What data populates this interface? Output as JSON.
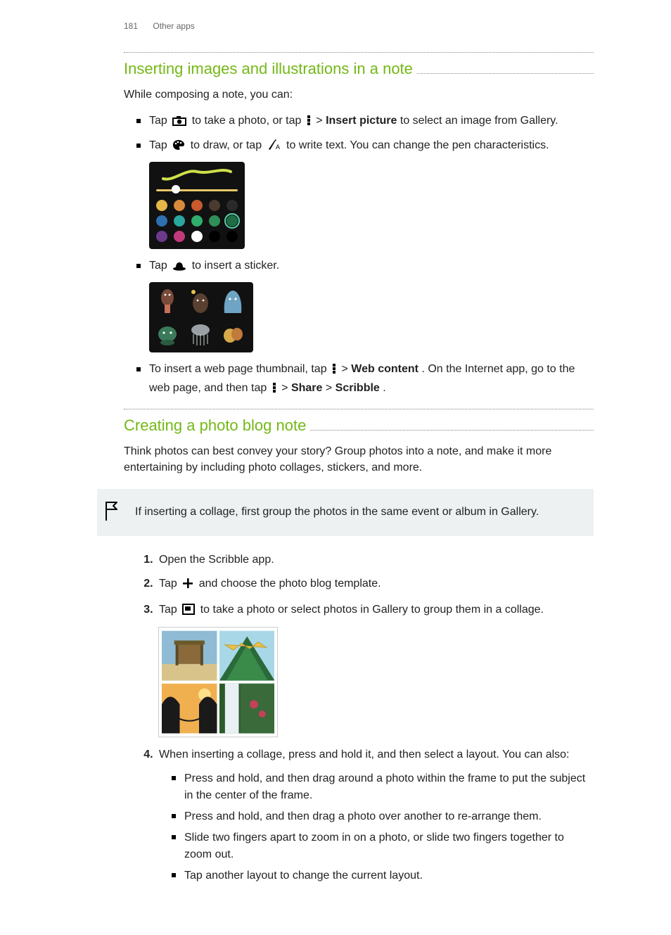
{
  "header": {
    "page_number": "181",
    "section": "Other apps"
  },
  "s1": {
    "title": "Inserting images and illustrations in a note",
    "intro": "While composing a note, you can:",
    "b1_a": "Tap ",
    "b1_b": " to take a photo, or tap ",
    "b1_c": " > ",
    "b1_d": "Insert picture",
    "b1_e": " to select an image from Gallery.",
    "b2_a": "Tap ",
    "b2_b": " to draw, or tap ",
    "b2_c": " to write text. You can change the pen characteristics.",
    "b3_a": "Tap ",
    "b3_b": " to insert a sticker.",
    "b4_a": "To insert a web page thumbnail, tap ",
    "b4_b": " > ",
    "b4_c": "Web content",
    "b4_d": ". On the Internet app, go to the web page, and then tap ",
    "b4_e": " > ",
    "b4_f": "Share",
    "b4_g": " > ",
    "b4_h": "Scribble",
    "b4_i": "."
  },
  "s2": {
    "title": "Creating a photo blog note",
    "intro": "Think photos can best convey your story? Group photos into a note, and make it more entertaining by including photo collages, stickers, and more.",
    "callout": "If inserting a collage, first group the photos in the same event or album in Gallery.",
    "o1": "Open the Scribble app.",
    "o2_a": "Tap ",
    "o2_b": " and choose the photo blog template.",
    "o3_a": "Tap ",
    "o3_b": " to take a photo or select photos in Gallery to group them in a collage.",
    "o4": "When inserting a collage, press and hold it, and then select a layout. You can also:",
    "sub1": "Press and hold, and then drag around a photo within the frame to put the subject in the center of the frame.",
    "sub2": "Press and hold, and then drag a photo over another to re-arrange them.",
    "sub3": "Slide two fingers apart to zoom in on a photo, or slide two fingers together to zoom out.",
    "sub4": "Tap another layout to change the current layout."
  },
  "palette_colors": [
    "#e6b64a",
    "#d88a3a",
    "#c85a2e",
    "#4a3a30",
    "#2a2a2a",
    "#2e6fb0",
    "#2aa6a0",
    "#2fae6e",
    "#2f8f59",
    "#1f6d44",
    "#6b3a8a",
    "#c33a7a",
    "#ffffff",
    "#000000",
    "#000000"
  ],
  "palette_selected_index": 9
}
